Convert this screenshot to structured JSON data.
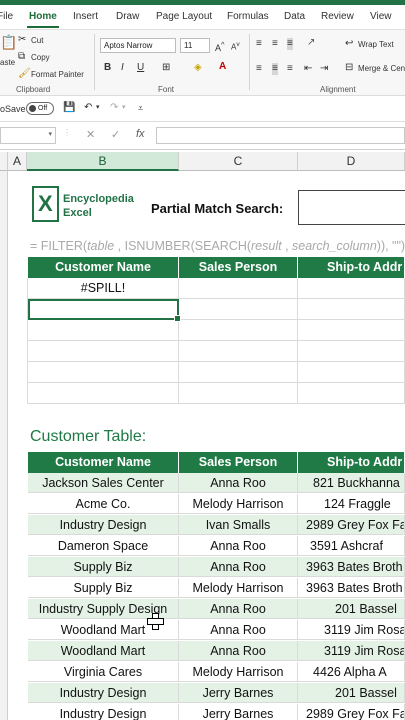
{
  "ribbon_tabs": [
    "File",
    "Home",
    "Insert",
    "Draw",
    "Page Layout",
    "Formulas",
    "Data",
    "Review",
    "View"
  ],
  "active_tab": "Home",
  "clipboard": {
    "paste_label": "aste",
    "cut_label": "Cut",
    "copy_label": "Copy",
    "format_painter_label": "Format Painter",
    "group_label": "Clipboard"
  },
  "font": {
    "name": "Aptos Narrow",
    "size": "11",
    "group_label": "Font",
    "bold": "B",
    "italic": "I",
    "underline": "U"
  },
  "alignment": {
    "wrap_text_label": "Wrap Text",
    "merge_label": "Merge & Cen",
    "group_label": "Alignment"
  },
  "qat": {
    "autosave_label": "oSave",
    "toggle_label": "Off"
  },
  "formula_bar": {
    "cancel": "✕",
    "enter": "✓",
    "fx": "fx"
  },
  "columns": [
    "A",
    "B",
    "C",
    "D"
  ],
  "selected_column": "B",
  "logo": {
    "line1": "Encyclopedia",
    "line2": "Excel"
  },
  "partial_match_label": "Partial Match Search:",
  "formula_display": {
    "prefix": "= FILTER(",
    "arg_table": "table",
    "mid1": " , ISNUMBER(SEARCH(",
    "arg_result": "result",
    "mid2": " , ",
    "arg_search": "search_column",
    "suffix": ")), \"\")"
  },
  "result_table": {
    "headers": [
      "Customer Name",
      "Sales Person",
      "Ship-to Addr"
    ],
    "first_value": "#SPILL!"
  },
  "customer_table_title": "Customer Table:",
  "customer_table": {
    "headers": [
      "Customer Name",
      "Sales Person",
      "Ship-to Addr"
    ],
    "rows": [
      [
        "Jackson Sales Center",
        "Anna Roo",
        "821 Buckhanna"
      ],
      [
        "Acme Co.",
        "Melody Harrison",
        "124 Fraggle"
      ],
      [
        "Industry Design",
        "Ivan Smalls",
        "2989 Grey Fox Fa"
      ],
      [
        "Dameron Space",
        "Anna Roo",
        "3591 Ashcraf"
      ],
      [
        "Supply Biz",
        "Anna Roo",
        "3963 Bates Broth"
      ],
      [
        "Supply Biz",
        "Melody Harrison",
        "3963 Bates Broth"
      ],
      [
        "Industry Supply Design",
        "Anna Roo",
        "201 Bassel"
      ],
      [
        "Woodland Mart",
        "Anna Roo",
        "3119 Jim Rosa"
      ],
      [
        "Woodland Mart",
        "Anna Roo",
        "3119 Jim Rosa"
      ],
      [
        "Virginia Cares",
        "Melody Harrison",
        "4426 Alpha A"
      ],
      [
        "Industry Design",
        "Jerry Barnes",
        "201 Bassel"
      ],
      [
        "Industry Design",
        "Jerry Barnes",
        "2989 Grey Fox Fa"
      ]
    ]
  },
  "colors": {
    "excel_green": "#217346",
    "header_fill": "#1f7a45",
    "band_fill": "#e3f2e5",
    "formula_gray": "#a9a9a9"
  }
}
